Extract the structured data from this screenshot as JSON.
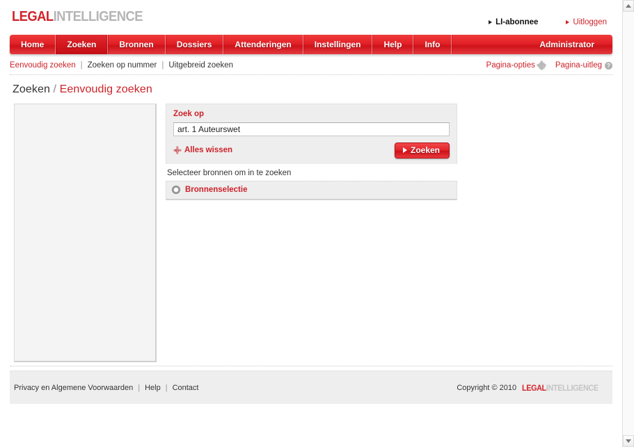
{
  "brand": {
    "logo_primary": "LEGAL",
    "logo_secondary": "INTELLIGENCE",
    "accent_color": "#cc2229",
    "gray_color": "#b5b5b5"
  },
  "userbar": {
    "account_label": "LI-abonnee",
    "logout_label": "Uitloggen"
  },
  "nav": {
    "items": [
      {
        "label": "Home",
        "active": false
      },
      {
        "label": "Zoeken",
        "active": true
      },
      {
        "label": "Bronnen",
        "active": false
      },
      {
        "label": "Dossiers",
        "active": false
      },
      {
        "label": "Attenderingen",
        "active": false
      },
      {
        "label": "Instellingen",
        "active": false
      },
      {
        "label": "Help",
        "active": false
      },
      {
        "label": "Info",
        "active": false
      }
    ],
    "right_item": "Administrator"
  },
  "subnav": {
    "items": [
      {
        "label": "Eenvoudig zoeken",
        "active": true
      },
      {
        "label": "Zoeken op nummer",
        "active": false
      },
      {
        "label": "Uitgebreid zoeken",
        "active": false
      }
    ],
    "separator": "|"
  },
  "pagetools": {
    "options_label": "Pagina-opties",
    "explain_label": "Pagina-uitleg",
    "help_glyph": "?"
  },
  "title": {
    "section": "Zoeken",
    "separator": "/",
    "current": "Eenvoudig zoeken"
  },
  "search": {
    "label": "Zoek op",
    "value": "art. 1 Auteurswet",
    "placeholder": "",
    "clear_label": "Alles wissen",
    "submit_label": "Zoeken",
    "sources_hint": "Selecteer bronnen om in te zoeken",
    "sources_label": "Bronnenselectie"
  },
  "footer": {
    "links": [
      {
        "label": "Privacy en Algemene Voorwaarden"
      },
      {
        "label": "Help"
      },
      {
        "label": "Contact"
      }
    ],
    "separator": "|",
    "copyright": "Copyright © 2010",
    "logo_primary": "LEGAL",
    "logo_secondary": "INTELLIGENCE"
  }
}
